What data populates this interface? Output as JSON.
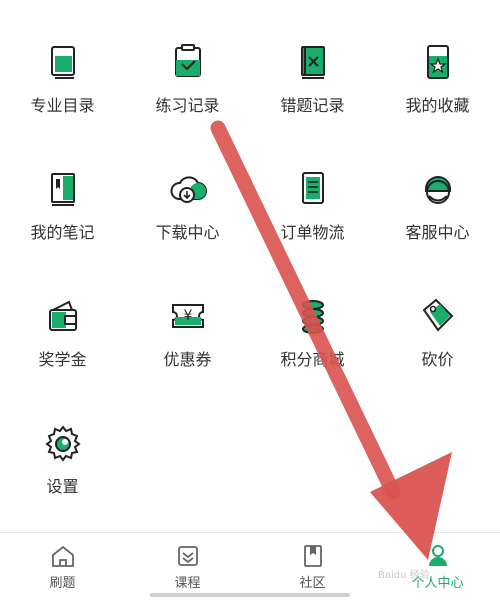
{
  "menu": {
    "items": [
      {
        "label": "专业目录",
        "icon": "book-icon"
      },
      {
        "label": "练习记录",
        "icon": "clipboard-check-icon"
      },
      {
        "label": "错题记录",
        "icon": "wrong-book-icon"
      },
      {
        "label": "我的收藏",
        "icon": "star-phone-icon"
      },
      {
        "label": "我的笔记",
        "icon": "notebook-icon"
      },
      {
        "label": "下载中心",
        "icon": "cloud-download-icon"
      },
      {
        "label": "订单物流",
        "icon": "order-list-icon"
      },
      {
        "label": "客服中心",
        "icon": "customer-service-icon"
      },
      {
        "label": "奖学金",
        "icon": "wallet-icon"
      },
      {
        "label": "优惠券",
        "icon": "coupon-icon"
      },
      {
        "label": "积分商城",
        "icon": "coins-icon"
      },
      {
        "label": "砍价",
        "icon": "price-tag-icon"
      },
      {
        "label": "设置",
        "icon": "gear-icon"
      }
    ]
  },
  "tabbar": {
    "tabs": [
      {
        "label": "刷题",
        "icon": "home-icon"
      },
      {
        "label": "课程",
        "icon": "course-icon"
      },
      {
        "label": "社区",
        "icon": "community-icon"
      },
      {
        "label": "个人中心",
        "icon": "person-icon",
        "active": true
      }
    ]
  },
  "overlay": {
    "watermark": "Baidu 经验"
  },
  "colors": {
    "accent": "#1aad6c",
    "arrow": "#d9534f",
    "text": "#333333"
  }
}
